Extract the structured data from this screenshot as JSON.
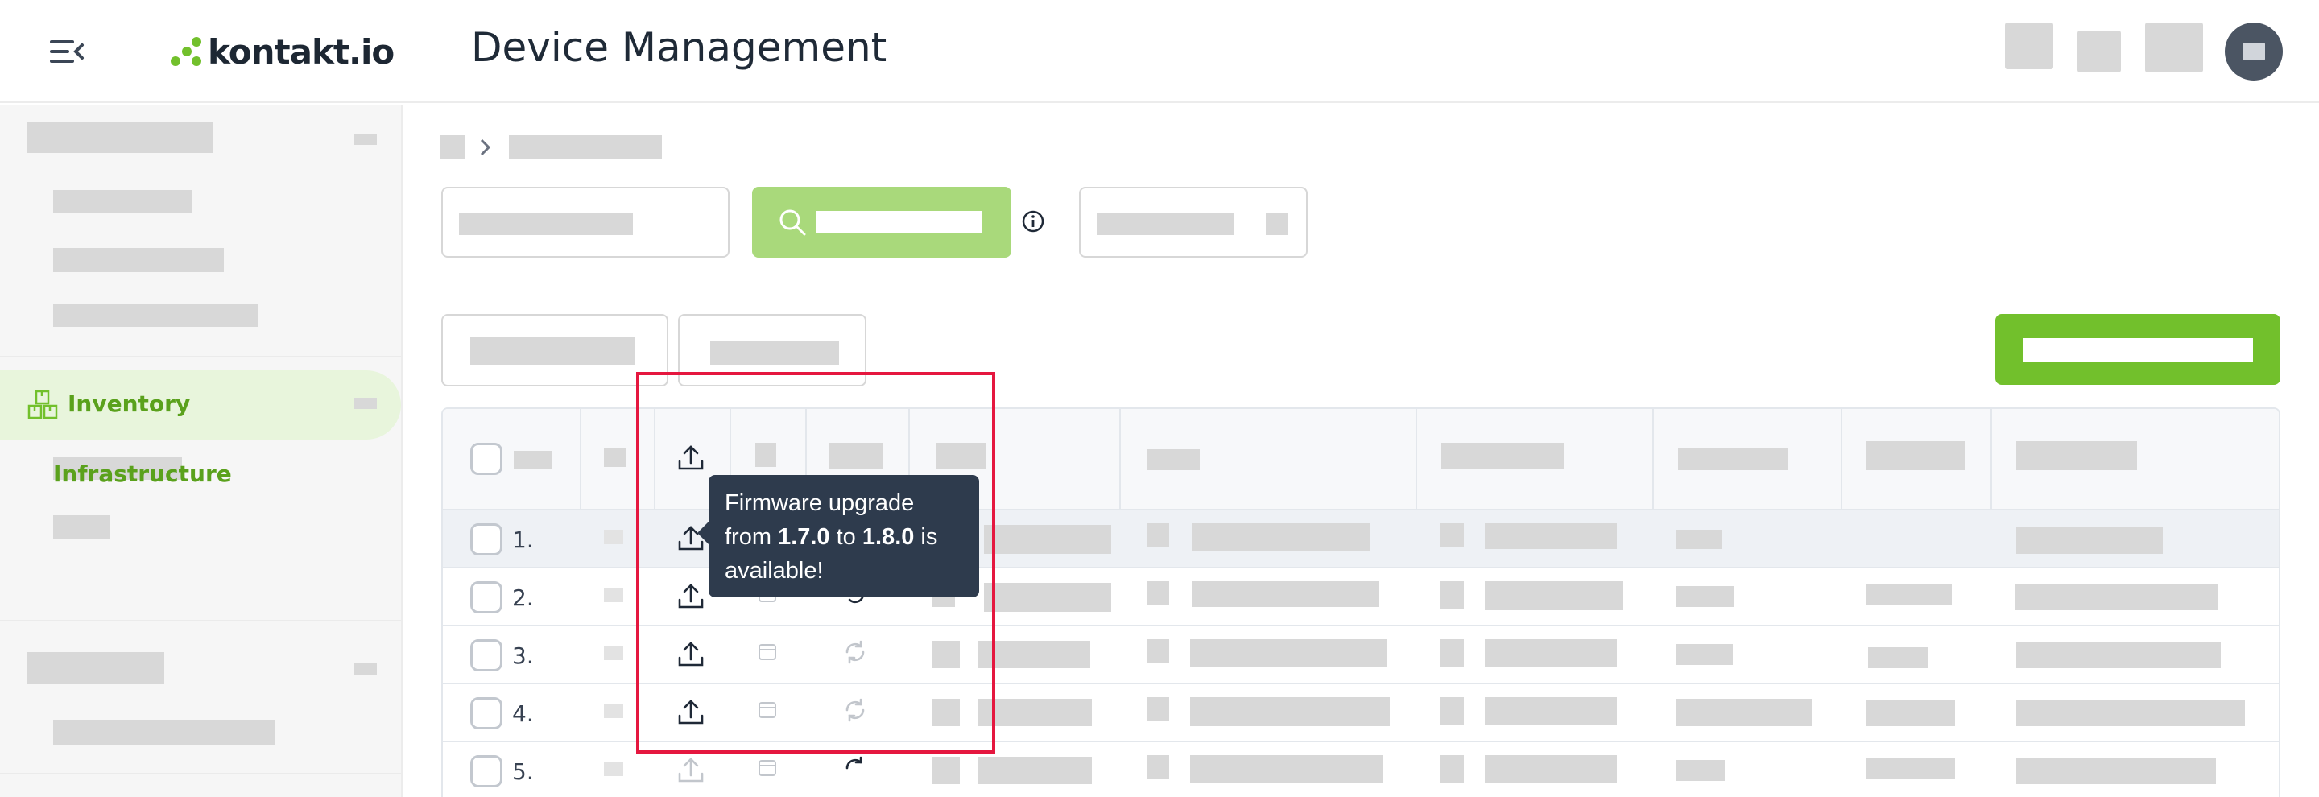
{
  "header": {
    "brand": "kontakt.io",
    "title": "Device Management"
  },
  "sidebar": {
    "active_item": "Inventory",
    "sub_item_active": "Infrastructure"
  },
  "table": {
    "rows": [
      {
        "num": "1."
      },
      {
        "num": "2."
      },
      {
        "num": "3."
      },
      {
        "num": "4."
      },
      {
        "num": "5."
      }
    ]
  },
  "tooltip": {
    "line1": "Firmware upgrade",
    "from_word": "from ",
    "from_version": "1.7.0",
    "to_word": " to ",
    "to_version": "1.8.0",
    "is_word": " is",
    "line3": "available!"
  },
  "colors": {
    "brand_green": "#72c02c",
    "active_text": "#5aa11c",
    "highlight_box": "#e5173f",
    "tooltip_bg": "#2e3b4d"
  },
  "icons": [
    "collapse-menu-icon",
    "search-icon",
    "info-icon",
    "upload-icon",
    "calendar-icon",
    "refresh-icon",
    "inventory-icon",
    "comment-icon"
  ]
}
